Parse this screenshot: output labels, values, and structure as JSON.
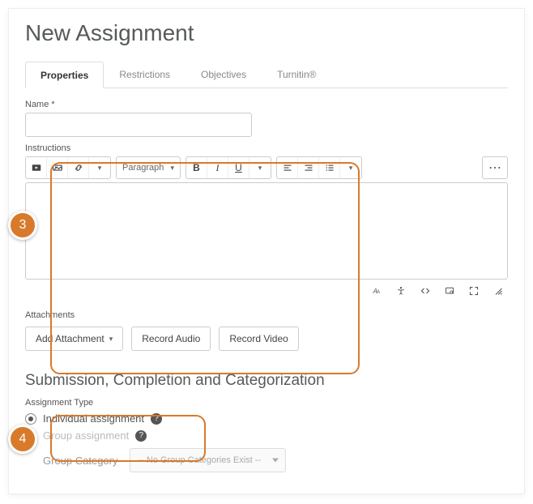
{
  "page_title": "New Assignment",
  "tabs": [
    "Properties",
    "Restrictions",
    "Objectives",
    "Turnitin®"
  ],
  "active_tab": 0,
  "name_label": "Name *",
  "name_value": "",
  "instructions_label": "Instructions",
  "editor": {
    "paragraph_label": "Paragraph",
    "bold": "B",
    "italic": "I",
    "underline": "U",
    "more": "⋯"
  },
  "attachments_label": "Attachments",
  "attachments_buttons": {
    "add": "Add Attachment",
    "audio": "Record Audio",
    "video": "Record Video"
  },
  "section_heading": "Submission, Completion and Categorization",
  "assignment_type_label": "Assignment Type",
  "assignment_type_options": {
    "individual": "Individual assignment",
    "group": "Group assignment"
  },
  "group_category_label": "Group Category",
  "group_category_value": "-- No Group Categories Exist --",
  "badges": {
    "step3": "3",
    "step4": "4"
  }
}
